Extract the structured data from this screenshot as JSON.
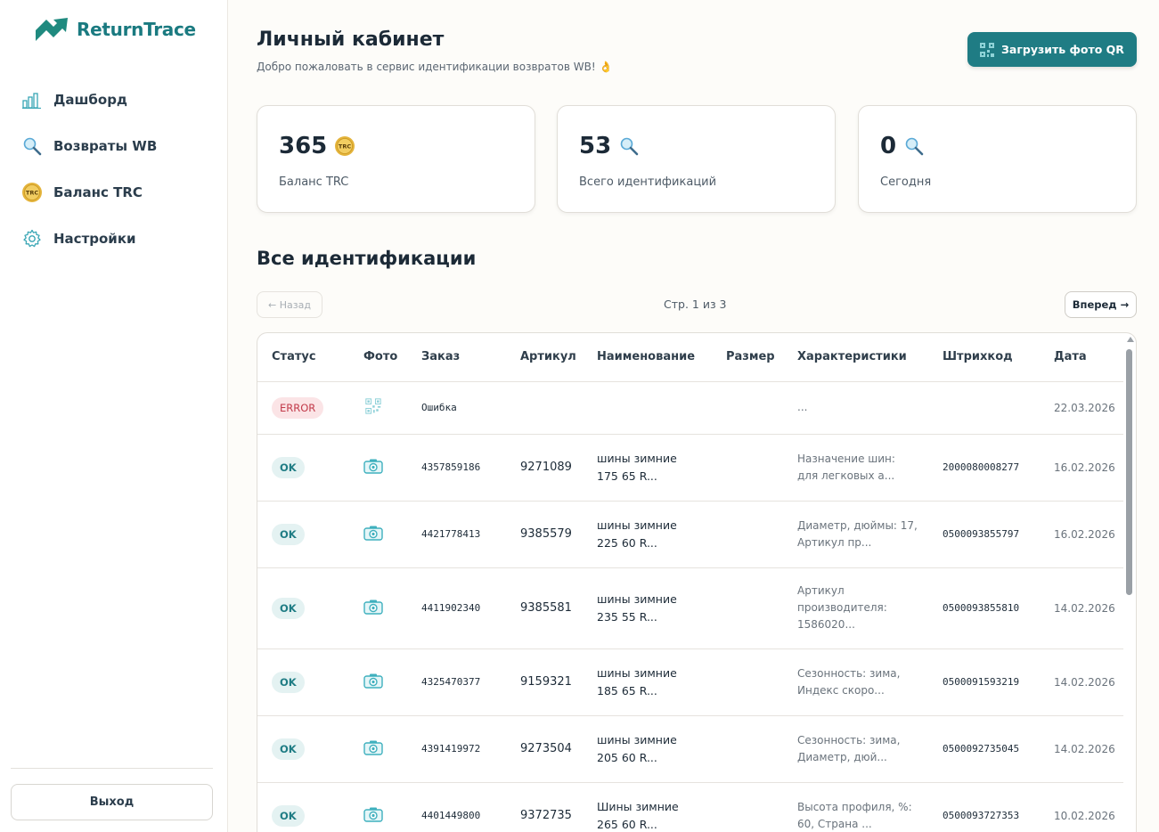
{
  "brand": {
    "name": "ReturnTrace",
    "accent": "#1f7c84"
  },
  "sidebar": {
    "items": [
      {
        "label": "Дашборд",
        "icon": "bar-chart-icon"
      },
      {
        "label": "Возвраты WB",
        "icon": "magnifier-icon"
      },
      {
        "label": "Баланс TRC",
        "icon": "trc-coin-icon"
      },
      {
        "label": "Настройки",
        "icon": "gear-icon"
      }
    ],
    "logout_label": "Выход"
  },
  "header": {
    "title": "Личный кабинет",
    "subtitle": "Добро пожаловать в сервис идентификации возвратов WB! 👌",
    "upload_label": "Загрузить фото QR"
  },
  "stats": [
    {
      "value": "365",
      "label": "Баланс TRC",
      "icon": "trc-coin-icon"
    },
    {
      "value": "53",
      "label": "Всего идентификаций",
      "icon": "magnifier-icon"
    },
    {
      "value": "0",
      "label": "Сегодня",
      "icon": "magnifier-icon"
    }
  ],
  "identifications": {
    "title": "Все идентификации",
    "prev_label": "← Назад",
    "page_info": "Стр. 1 из 3",
    "next_label": "Вперед →",
    "columns": [
      "Статус",
      "Фото",
      "Заказ",
      "Артикул",
      "Наименование",
      "Размер",
      "Характеристики",
      "Штрихкод",
      "Дата"
    ],
    "rows": [
      {
        "status": "ERROR",
        "photo": "qr-icon",
        "order": "Ошибка",
        "article": "",
        "name": "",
        "size": "",
        "chars": "...",
        "barcode": "",
        "date": "22.03.2026"
      },
      {
        "status": "OK",
        "photo": "camera-icon",
        "order": "4357859186",
        "article": "9271089",
        "name": "шины зимние 175 65 R...",
        "size": "",
        "chars": "Назначение шин: для легковых а...",
        "barcode": "2000080008277",
        "date": "16.02.2026"
      },
      {
        "status": "OK",
        "photo": "camera-icon",
        "order": "4421778413",
        "article": "9385579",
        "name": "шины зимние 225 60 R...",
        "size": "",
        "chars": "Диаметр, дюймы: 17, Артикул пр...",
        "barcode": "0500093855797",
        "date": "16.02.2026"
      },
      {
        "status": "OK",
        "photo": "camera-icon",
        "order": "4411902340",
        "article": "9385581",
        "name": "шины зимние 235 55 R...",
        "size": "",
        "chars": "Артикул производителя: 1586020...",
        "barcode": "0500093855810",
        "date": "14.02.2026"
      },
      {
        "status": "OK",
        "photo": "camera-icon",
        "order": "4325470377",
        "article": "9159321",
        "name": "шины зимние 185 65 R...",
        "size": "",
        "chars": "Сезонность: зима, Индекс скоро...",
        "barcode": "0500091593219",
        "date": "14.02.2026"
      },
      {
        "status": "OK",
        "photo": "camera-icon",
        "order": "4391419972",
        "article": "9273504",
        "name": "шины зимние 205 60 R...",
        "size": "",
        "chars": "Сезонность: зима, Диаметр, дюй...",
        "barcode": "0500092735045",
        "date": "14.02.2026"
      },
      {
        "status": "OK",
        "photo": "camera-icon",
        "order": "4401449800",
        "article": "9372735",
        "name": "Шины зимние 265 60 R...",
        "size": "",
        "chars": "Высота профиля, %: 60, Страна ...",
        "barcode": "0500093727353",
        "date": "10.02.2026"
      }
    ]
  }
}
